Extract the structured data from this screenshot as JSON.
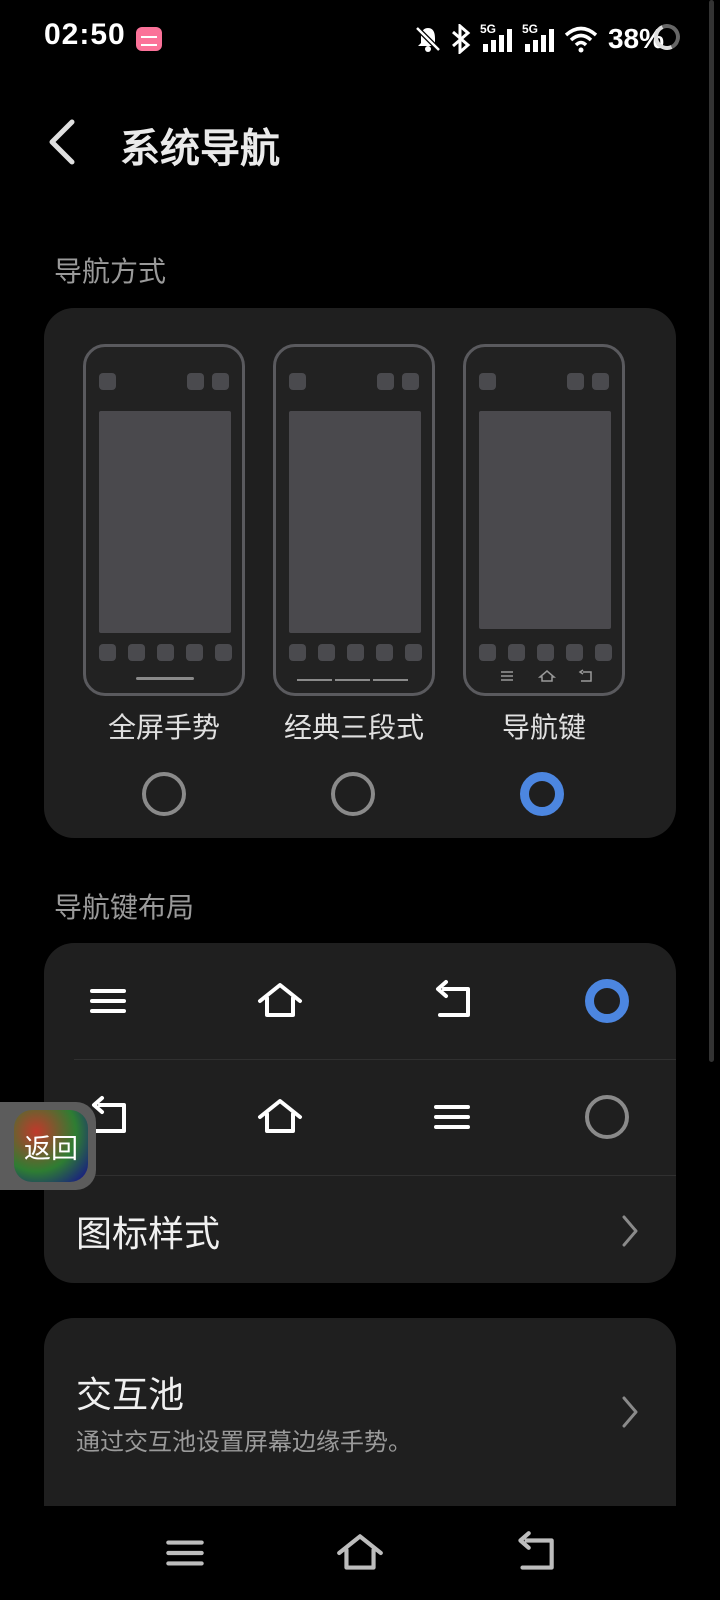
{
  "status_bar": {
    "time": "02:50",
    "network_1": "5G",
    "network_2": "5G",
    "battery": "38%"
  },
  "header": {
    "title": "系统导航"
  },
  "nav_mode": {
    "section_label": "导航方式",
    "options": [
      {
        "label": "全屏手势",
        "selected": false
      },
      {
        "label": "经典三段式",
        "selected": false
      },
      {
        "label": "导航键",
        "selected": true
      }
    ]
  },
  "key_layout": {
    "section_label": "导航键布局",
    "rows": [
      {
        "icons": [
          "menu-icon",
          "home-icon",
          "back-icon"
        ],
        "selected": true
      },
      {
        "icons": [
          "back-icon",
          "home-icon",
          "menu-icon"
        ],
        "selected": false
      }
    ],
    "icon_style_label": "图标样式"
  },
  "interaction_pool": {
    "title": "交互池",
    "subtitle": "通过交互池设置屏幕边缘手势。"
  },
  "floating_button": {
    "label": "返回"
  },
  "colors": {
    "accent": "#4c86e0",
    "card": "#1f1f1f",
    "background": "#000000"
  }
}
